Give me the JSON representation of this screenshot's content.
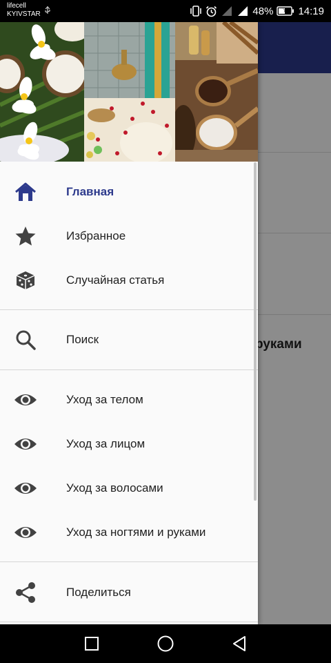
{
  "status_bar": {
    "carrier_line1": "lifecell",
    "carrier_line2": "KYIVSTAR",
    "battery": "48%",
    "time": "14:19",
    "icons": [
      "usb-icon",
      "vibrate-icon",
      "alarm-icon",
      "signal-icon",
      "signal-icon",
      "battery-charging-icon"
    ]
  },
  "background_app": {
    "visible_text": "руками",
    "toolbar_color": "#2d3a8c"
  },
  "drawer": {
    "accent_color": "#2d3a8c",
    "header_images": [
      "frangipani-coconut-photo",
      "hammam-rose-petals-photo",
      "coffee-salt-spoons-photo"
    ],
    "items": [
      {
        "label": "Главная",
        "icon": "home-icon",
        "active": true
      },
      {
        "label": "Избранное",
        "icon": "star-icon",
        "active": false
      },
      {
        "label": "Случайная статья",
        "icon": "dice-icon",
        "active": false
      },
      {
        "label": "Поиск",
        "icon": "search-icon",
        "active": false
      },
      {
        "label": "Уход за телом",
        "icon": "eye-icon",
        "active": false
      },
      {
        "label": "Уход за лицом",
        "icon": "eye-icon",
        "active": false
      },
      {
        "label": "Уход за волосами",
        "icon": "eye-icon",
        "active": false
      },
      {
        "label": "Уход за ногтями и руками",
        "icon": "eye-icon",
        "active": false
      },
      {
        "label": "Поделиться",
        "icon": "share-icon",
        "active": false
      }
    ]
  },
  "nav_bar": {
    "buttons": [
      "recents-button",
      "home-button",
      "back-button"
    ]
  }
}
